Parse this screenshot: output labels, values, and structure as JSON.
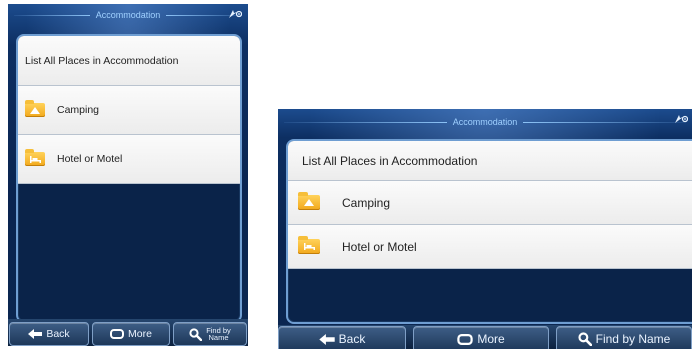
{
  "screen_title": "Accommodation",
  "gps_indicator": "★◎",
  "list": {
    "all_places": "List All Places in Accommodation",
    "items": [
      {
        "label": "Camping",
        "icon": "camping-folder-icon"
      },
      {
        "label": "Hotel or Motel",
        "icon": "hotel-folder-icon"
      }
    ]
  },
  "portrait_toolbar": {
    "back": "Back",
    "more": "More",
    "find_line1": "Find by",
    "find_line2": "Name"
  },
  "landscape_toolbar": {
    "back": "Back",
    "more": "More",
    "find": "Find by Name"
  },
  "colors": {
    "background": "#0a2450",
    "folder": "#f2a81c",
    "title_text": "#9fd0ff"
  }
}
